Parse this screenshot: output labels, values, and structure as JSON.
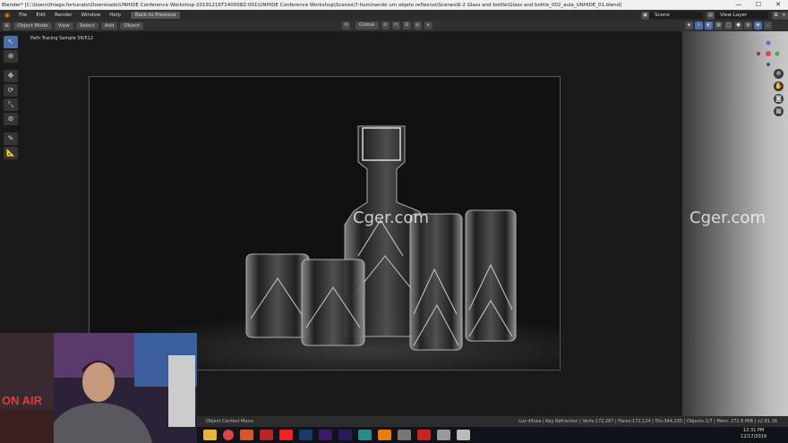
{
  "window": {
    "title": "Blender* [C:\\Users\\thiago.fortunato\\Downloads\\UNHIDE Conference Workshop-20191216T140008Z-001\\UNHIDE Conference Workshop\\Scenes\\7-Iluminando um objeto reflexivo\\Scenes\\6-2 Glass and bottle\\Glass and bottle_002_aula_UNHIDE_01.blend]",
    "minimize": "—",
    "maximize": "☐",
    "close": "✕"
  },
  "menu": {
    "items": [
      "File",
      "Edit",
      "Render",
      "Window",
      "Help"
    ],
    "back_button": "Back to Previous",
    "scene_field": "Scene",
    "view_layer_field": "View Layer"
  },
  "header": {
    "mode": "Object Mode",
    "view": "View",
    "select": "Select",
    "add": "Add",
    "object": "Object",
    "orientation": "Global"
  },
  "viewport": {
    "sample_text": "Path Tracing Sample 56/512"
  },
  "watermarks": [
    "Cger.com",
    "Cger.com"
  ],
  "webcam": {
    "sign_text": "ON AIR"
  },
  "statusbar": {
    "left": "Object Context Menu",
    "right": "Luz difusa | Key Refraction | Verts:172,287 | Faces:172,124 | Tris:344,235 | Objects:1/7 | Mem: 272.8 MiB | v2.81.16"
  },
  "taskbar": {
    "time": "12:31 PM",
    "date": "12/17/2019"
  },
  "colors": {
    "accent": "#4b6fa6",
    "gizmo_x": "#e8414f",
    "gizmo_y": "#5ea14b",
    "gizmo_z": "#4a7ad6"
  }
}
